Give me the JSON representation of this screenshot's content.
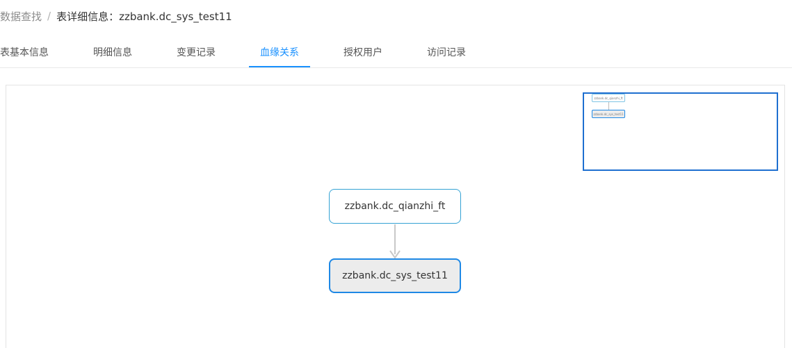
{
  "breadcrumb": {
    "root": "数据查找",
    "separator": "/",
    "current": "表详细信息：zzbank.dc_sys_test11"
  },
  "tabs": [
    {
      "label": "表基本信息",
      "active": false
    },
    {
      "label": "明细信息",
      "active": false
    },
    {
      "label": "变更记录",
      "active": false
    },
    {
      "label": "血缘关系",
      "active": true
    },
    {
      "label": "授权用户",
      "active": false
    },
    {
      "label": "访问记录",
      "active": false
    }
  ],
  "lineage": {
    "upstream_node": "zzbank.dc_qianzhi_ft",
    "current_node": "zzbank.dc_sys_test11"
  },
  "minimap": {
    "upstream_node": "zzbank.dc_qianzhi_ft",
    "current_node": "zzbank.dc_sys_test11"
  },
  "colors": {
    "accent": "#1890ff",
    "node_border": "#33a2d4",
    "current_node_fill": "#ececec",
    "edge": "#c8c8c8"
  }
}
